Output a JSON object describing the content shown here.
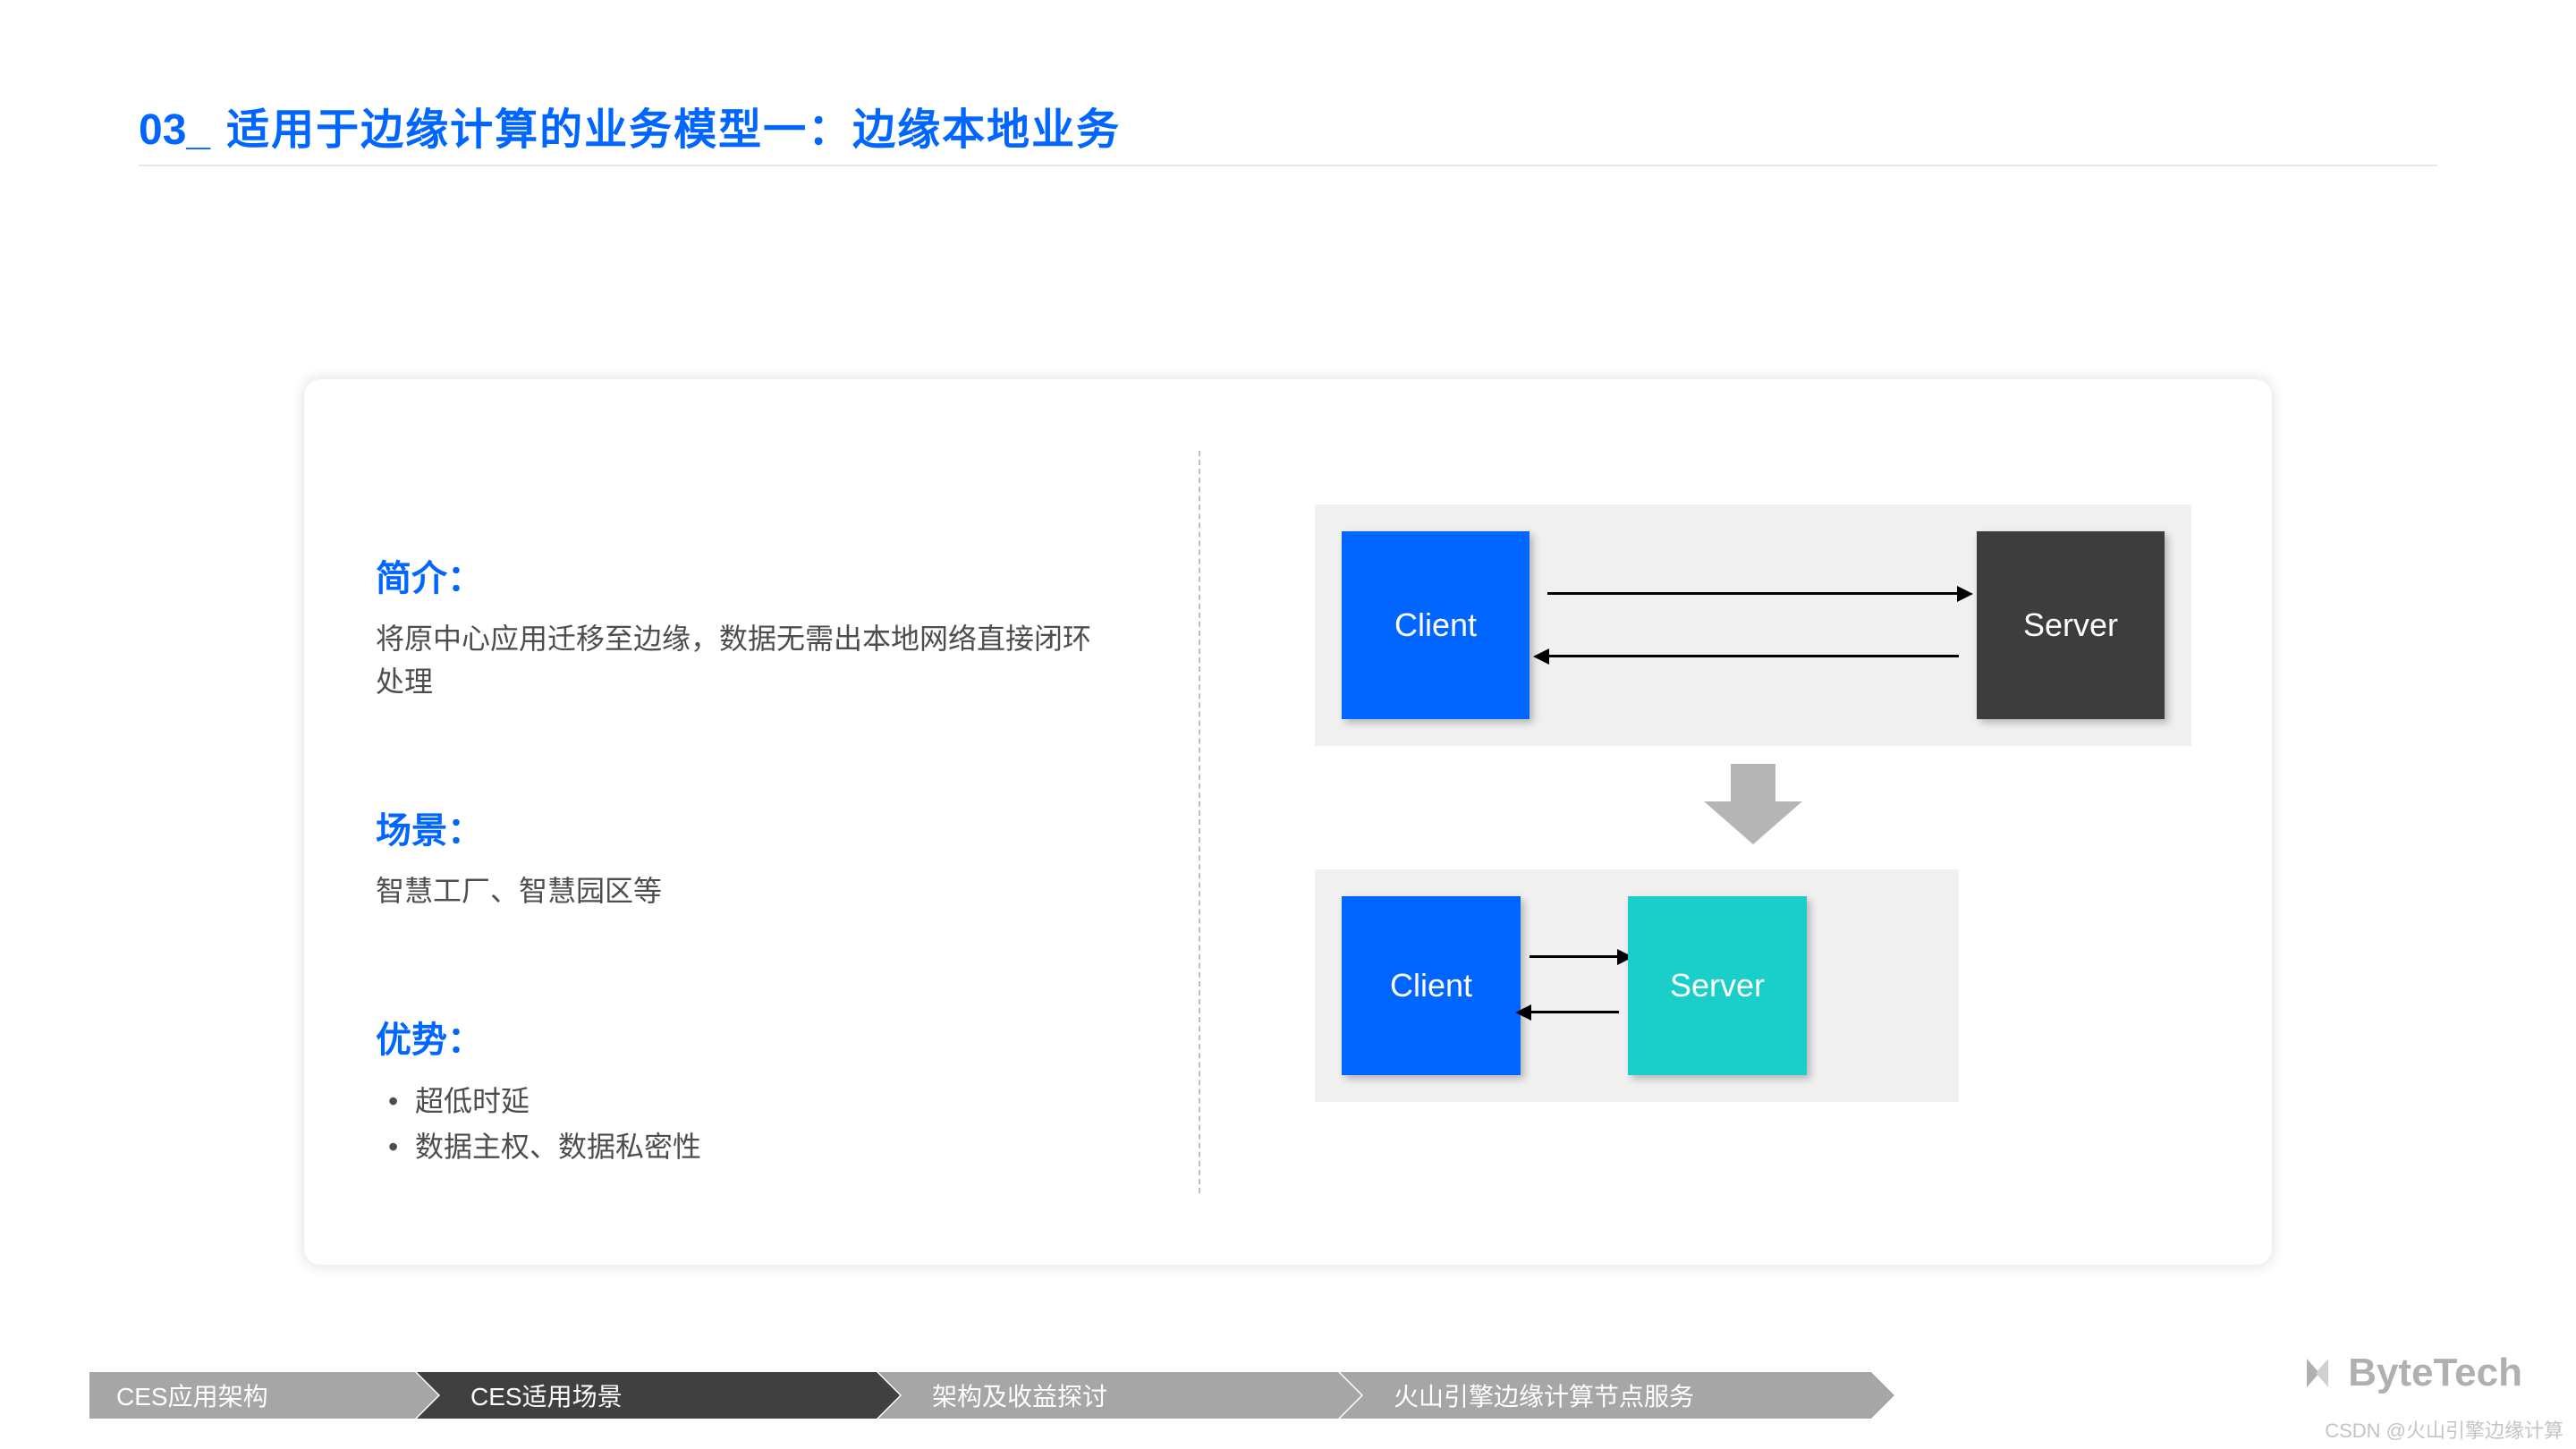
{
  "title": {
    "number": "03_",
    "text": "适用于边缘计算的业务模型一：边缘本地业务"
  },
  "sections": {
    "intro": {
      "heading": "简介：",
      "body": "将原中心应用迁移至边缘，数据无需出本地网络直接闭环处理"
    },
    "scenario": {
      "heading": "场景：",
      "body": "智慧工厂、智慧园区等"
    },
    "advantage": {
      "heading": "优势：",
      "items": [
        "超低时延",
        "数据主权、数据私密性"
      ]
    }
  },
  "diagram": {
    "top": {
      "client_label": "Client",
      "server_label": "Server"
    },
    "bottom": {
      "client_label": "Client",
      "server_label": "Server"
    }
  },
  "nav": {
    "items": [
      {
        "label": "CES应用架构",
        "active": false
      },
      {
        "label": "CES适用场景",
        "active": true
      },
      {
        "label": "架构及收益探讨",
        "active": false
      },
      {
        "label": "火山引擎边缘计算节点服务",
        "active": false
      }
    ]
  },
  "logo": {
    "text": "ByteTech"
  },
  "watermark": "CSDN @火山引擎边缘计算"
}
